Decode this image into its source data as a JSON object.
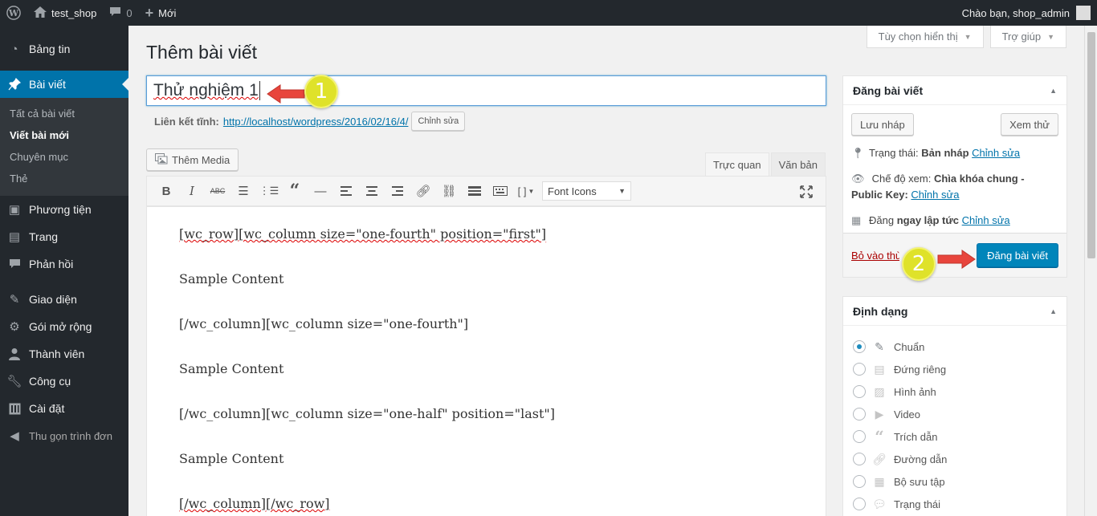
{
  "admin_bar": {
    "site_name": "test_shop",
    "comments_count": "0",
    "new_label": "Mới",
    "greeting": "Chào bạn, shop_admin"
  },
  "sidebar": {
    "items": [
      {
        "label": "Bảng tin",
        "icon": "dashboard-icon"
      },
      {
        "label": "Bài viết",
        "icon": "pin-icon",
        "active": true
      },
      {
        "label": "Phương tiện",
        "icon": "media-icon"
      },
      {
        "label": "Trang",
        "icon": "page-icon"
      },
      {
        "label": "Phản hồi",
        "icon": "comment-icon"
      },
      {
        "label": "Giao diện",
        "icon": "appearance-icon"
      },
      {
        "label": "Gói mở rộng",
        "icon": "plugin-icon"
      },
      {
        "label": "Thành viên",
        "icon": "user-icon"
      },
      {
        "label": "Công cụ",
        "icon": "tools-icon"
      },
      {
        "label": "Cài đặt",
        "icon": "settings-icon"
      }
    ],
    "submenu": [
      "Tất cả bài viết",
      "Viết bài mới",
      "Chuyên mục",
      "Thẻ"
    ],
    "collapse_label": "Thu gọn trình đơn"
  },
  "screen_options": {
    "screen_label": "Tùy chọn hiển thị",
    "help_label": "Trợ giúp"
  },
  "page": {
    "title": "Thêm bài viết",
    "post_title": "Thử nghiệm 1",
    "permalink_label": "Liên kết tĩnh:",
    "permalink_url": "http://localhost/wordpress/2016/02/16/4/",
    "permalink_edit": "Chỉnh sửa"
  },
  "editor": {
    "add_media": "Thêm Media",
    "tab_visual": "Trực quan",
    "tab_text": "Văn bản",
    "font_select": "Font Icons",
    "shortcode_btn": "[ ]",
    "content": [
      "[wc_row][wc_column size=\"one-fourth\" position=\"first\"]",
      "Sample Content",
      "[/wc_column][wc_column size=\"one-fourth\"]",
      "Sample Content",
      "[/wc_column][wc_column size=\"one-half\" position=\"last\"]",
      "Sample Content",
      "[/wc_column][/wc_row]"
    ]
  },
  "publish": {
    "title": "Đăng bài viết",
    "save_draft": "Lưu nháp",
    "preview": "Xem thử",
    "status_label": "Trạng thái:",
    "status_value": "Bản nháp",
    "visibility_label": "Chế độ xem:",
    "visibility_value": "Chìa khóa chung - Public Key:",
    "schedule_label": "Đăng",
    "schedule_value": "ngay lập tức",
    "edit_link": "Chỉnh sửa",
    "trash": "Bỏ vào thùng rác",
    "publish_button": "Đăng bài viết"
  },
  "format": {
    "title": "Định dạng",
    "options": [
      {
        "label": "Chuẩn",
        "selected": true
      },
      {
        "label": "Đứng riêng"
      },
      {
        "label": "Hình ảnh"
      },
      {
        "label": "Video"
      },
      {
        "label": "Trích dẫn"
      },
      {
        "label": "Đường dẫn"
      },
      {
        "label": "Bộ sưu tập"
      },
      {
        "label": "Trạng thái"
      }
    ]
  },
  "annotations": {
    "badge_1": "1",
    "badge_2": "2",
    "arrow_color": "#e8453c",
    "badge_color": "#dfe22a"
  },
  "colors": {
    "admin_bar": "#23282d",
    "active_menu": "#0073aa",
    "primary_button": "#0085ba"
  }
}
